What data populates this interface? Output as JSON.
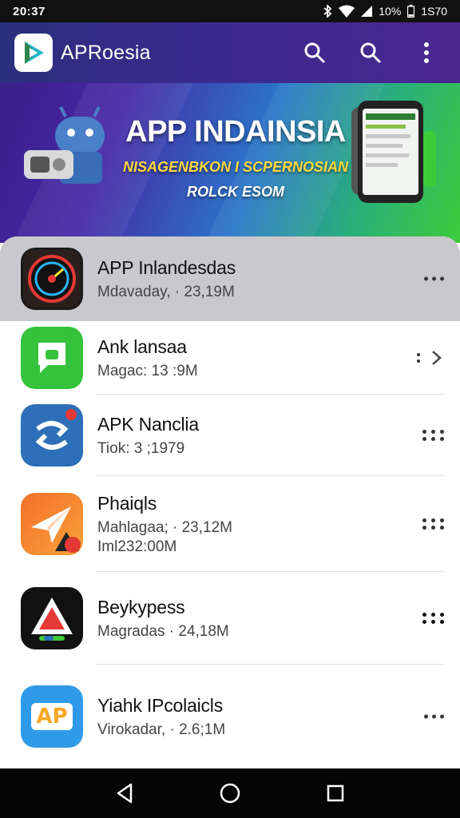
{
  "status_bar": {
    "time": "20:37",
    "battery_text": "10%",
    "right_text": "1S70"
  },
  "app_bar": {
    "title": "APRoesia",
    "logo_icon": "play-logo-icon",
    "actions": [
      "search-icon",
      "search-icon",
      "more-vert-icon"
    ]
  },
  "banner": {
    "title": "APP INDAINSIA",
    "subtitle": "NISAGENBKON I SCPERNOSIAN",
    "subtitle2": "ROLCK ESOM",
    "colors": {
      "start": "#3b1d8a",
      "mid": "#2a76c9",
      "end": "#3ecb3a"
    }
  },
  "apps": [
    {
      "name": "APP Inlandesdas",
      "meta": "Mdavaday, · 23,19M",
      "meta2": "",
      "icon": "dashboard-gauge-icon",
      "action": "more-icon",
      "highlighted": true
    },
    {
      "name": "Ank lansaa",
      "meta": "Magac: 13 :9M",
      "meta2": "",
      "icon": "chat-icon",
      "action": "chevron-right-icon",
      "highlighted": false
    },
    {
      "name": "APK Nanclia",
      "meta": "Tiok: 3 ;1979",
      "meta2": "",
      "icon": "refresh-arrow-icon",
      "action": "grid-icon",
      "highlighted": false
    },
    {
      "name": "Phaiqls",
      "meta": "Mahlagaa; · 23,12M",
      "meta2": "Iml232:00M",
      "icon": "paper-plane-icon",
      "action": "grid-icon",
      "highlighted": false
    },
    {
      "name": "Beykypess",
      "meta": "Magradas · 24,18M",
      "meta2": "",
      "icon": "warning-triangle-icon",
      "action": "grid-bold-icon",
      "highlighted": false
    },
    {
      "name": "Yiahk IPcolaicls",
      "meta": "Virokadar, · 2.6;1M",
      "meta2": "",
      "icon": "app-letters-icon",
      "action": "more-icon",
      "highlighted": false
    }
  ],
  "app_icon_text": "AP",
  "nav": [
    "back-icon",
    "home-icon",
    "recents-icon"
  ]
}
